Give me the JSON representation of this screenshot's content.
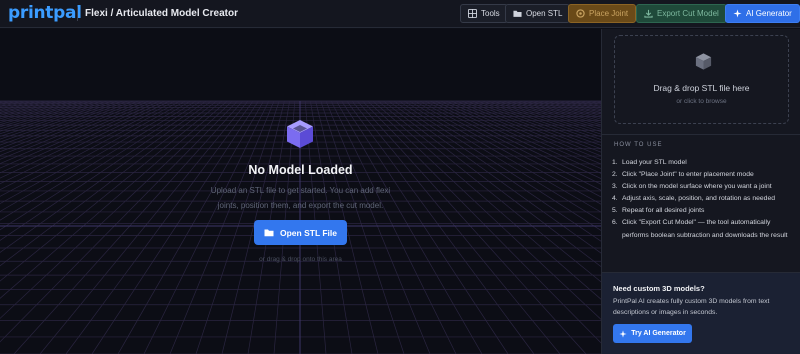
{
  "header": {
    "logo": "printpal",
    "title": "Flexi / Articulated Model Creator",
    "buttons": {
      "tools": "Tools",
      "open_stl": "Open STL",
      "place_joint": "Place Joint",
      "export_cut": "Export Cut Model",
      "ai_generator": "AI Generator"
    }
  },
  "viewport": {
    "empty_title": "No Model Loaded",
    "empty_desc": "Upload an STL file to get started. You can add flexi joints, position them, and export the cut model.",
    "open_button": "Open STL File",
    "drop_hint": "or drag & drop onto this area"
  },
  "sidebar": {
    "dropzone": {
      "title": "Drag & drop STL file here",
      "subtitle": "or click to browse"
    },
    "how_to": {
      "heading": "HOW TO USE",
      "steps": [
        {
          "num": "1.",
          "text": "Load your STL model"
        },
        {
          "num": "2.",
          "text": "Click \"Place Joint\" to enter placement mode"
        },
        {
          "num": "3.",
          "text": "Click on the model surface where you want a joint"
        },
        {
          "num": "4.",
          "text": "Adjust axis, scale, position, and rotation as needed"
        },
        {
          "num": "5.",
          "text": "Repeat for all desired joints"
        },
        {
          "num": "6.",
          "text": "Click \"Export Cut Model\" — the tool automatically performs boolean subtraction and downloads the result"
        }
      ]
    },
    "promo": {
      "heading": "Need custom 3D models?",
      "text": "PrintPal AI creates fully custom 3D models from text descriptions or images in seconds.",
      "button": "Try AI Generator"
    }
  },
  "colors": {
    "accent": "#3377ee",
    "logo": "#3b9cff",
    "cube": "#7b6cf0",
    "place_joint": "#6a4a18",
    "export": "#1f4a3a"
  }
}
